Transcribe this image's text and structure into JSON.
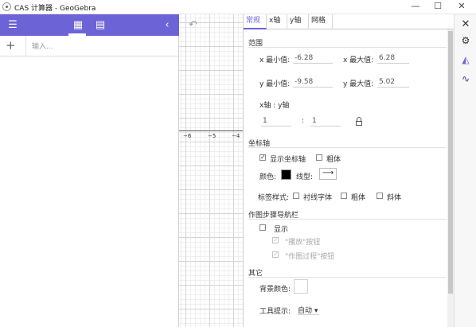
{
  "window": {
    "title": "CAS 计算器 - GeoGebra",
    "minimize": "—",
    "maximize": "☐",
    "close": "✕"
  },
  "cas": {
    "menu_icon": "☰",
    "calculator_icon": "▦",
    "table_icon": "▤",
    "collapse_icon": "‹",
    "add_icon": "+",
    "input_placeholder": "输入..."
  },
  "graphics": {
    "undo_icon": "↶",
    "x_ticks": [
      "−6",
      "−5",
      "−4"
    ]
  },
  "settings": {
    "tabs": [
      "常规",
      "x轴",
      "y轴",
      "网格"
    ],
    "active_tab": "常规",
    "range": {
      "title": "范围",
      "xmin_label": "x 最小值:",
      "xmin": "-6.28",
      "xmax_label": "x 最大值:",
      "xmax": "6.28",
      "ymin_label": "y 最小值:",
      "ymin": "-9.58",
      "ymax_label": "y 最大值:",
      "ymax": "5.02",
      "ratio_label": "x轴 : y轴",
      "ratio_x": "1",
      "ratio_sep": ":",
      "ratio_y": "1"
    },
    "axes": {
      "title": "坐标轴",
      "show_axes_label": "显示坐标轴",
      "show_axes_check": "✓",
      "bold_label": "粗体",
      "color_label": "颜色:",
      "axes_color": "#000000",
      "line_style_label": "线型:",
      "line_style_value": "⟶",
      "label_style_label": "标签样式:",
      "serif_label": "衬线字体",
      "label_bold_label": "粗体",
      "italic_label": "斜体"
    },
    "navbar": {
      "title": "作图步骤导航栏",
      "show_label": "显示",
      "play_label": "\"播放\"按钮",
      "play_check": "✓",
      "construction_label": "\"作图过程\"按钮",
      "construction_check": "✓"
    },
    "other": {
      "title": "其它",
      "background_label": "背景颜色:",
      "background_color": "#ffffff",
      "tooltips_label": "工具提示:",
      "tooltips_value": "自动 ▾"
    }
  },
  "dock": {
    "close_icon": "✕",
    "gear_icon": "⚙",
    "graph_icon": "◭",
    "curve_icon": "∿"
  },
  "colors": {
    "accent": "#6c63d6"
  }
}
